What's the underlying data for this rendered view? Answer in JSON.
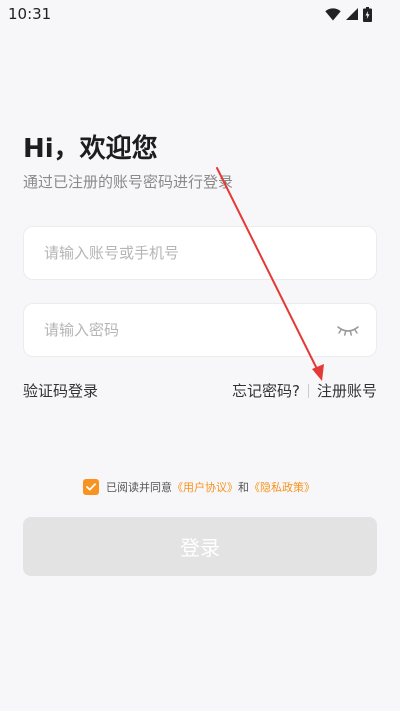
{
  "status_bar": {
    "time": "10:31",
    "icons": [
      "wifi-icon",
      "cellular-signal-icon",
      "battery-icon"
    ]
  },
  "header": {
    "greeting": "Hi，欢迎您",
    "subtitle": "通过已注册的账号密码进行登录"
  },
  "form": {
    "account_placeholder": "请输入账号或手机号",
    "account_value": "",
    "password_placeholder": "请输入密码",
    "password_value": "",
    "password_toggle_icon": "eye-closed-icon"
  },
  "links": {
    "sms_login": "验证码登录",
    "forgot_password": "忘记密码?",
    "register": "注册账号"
  },
  "agreement": {
    "checked": true,
    "prefix": "已阅读并同意",
    "user_agreement": "《用户协议》",
    "conjunction": "和",
    "privacy_policy": "《隐私政策》"
  },
  "login_button": {
    "label": "登录"
  },
  "colors": {
    "accent": "#f7931e",
    "background": "#f7f7f9",
    "button_disabled": "#e3e3e3",
    "annotation_arrow": "#e53935"
  }
}
